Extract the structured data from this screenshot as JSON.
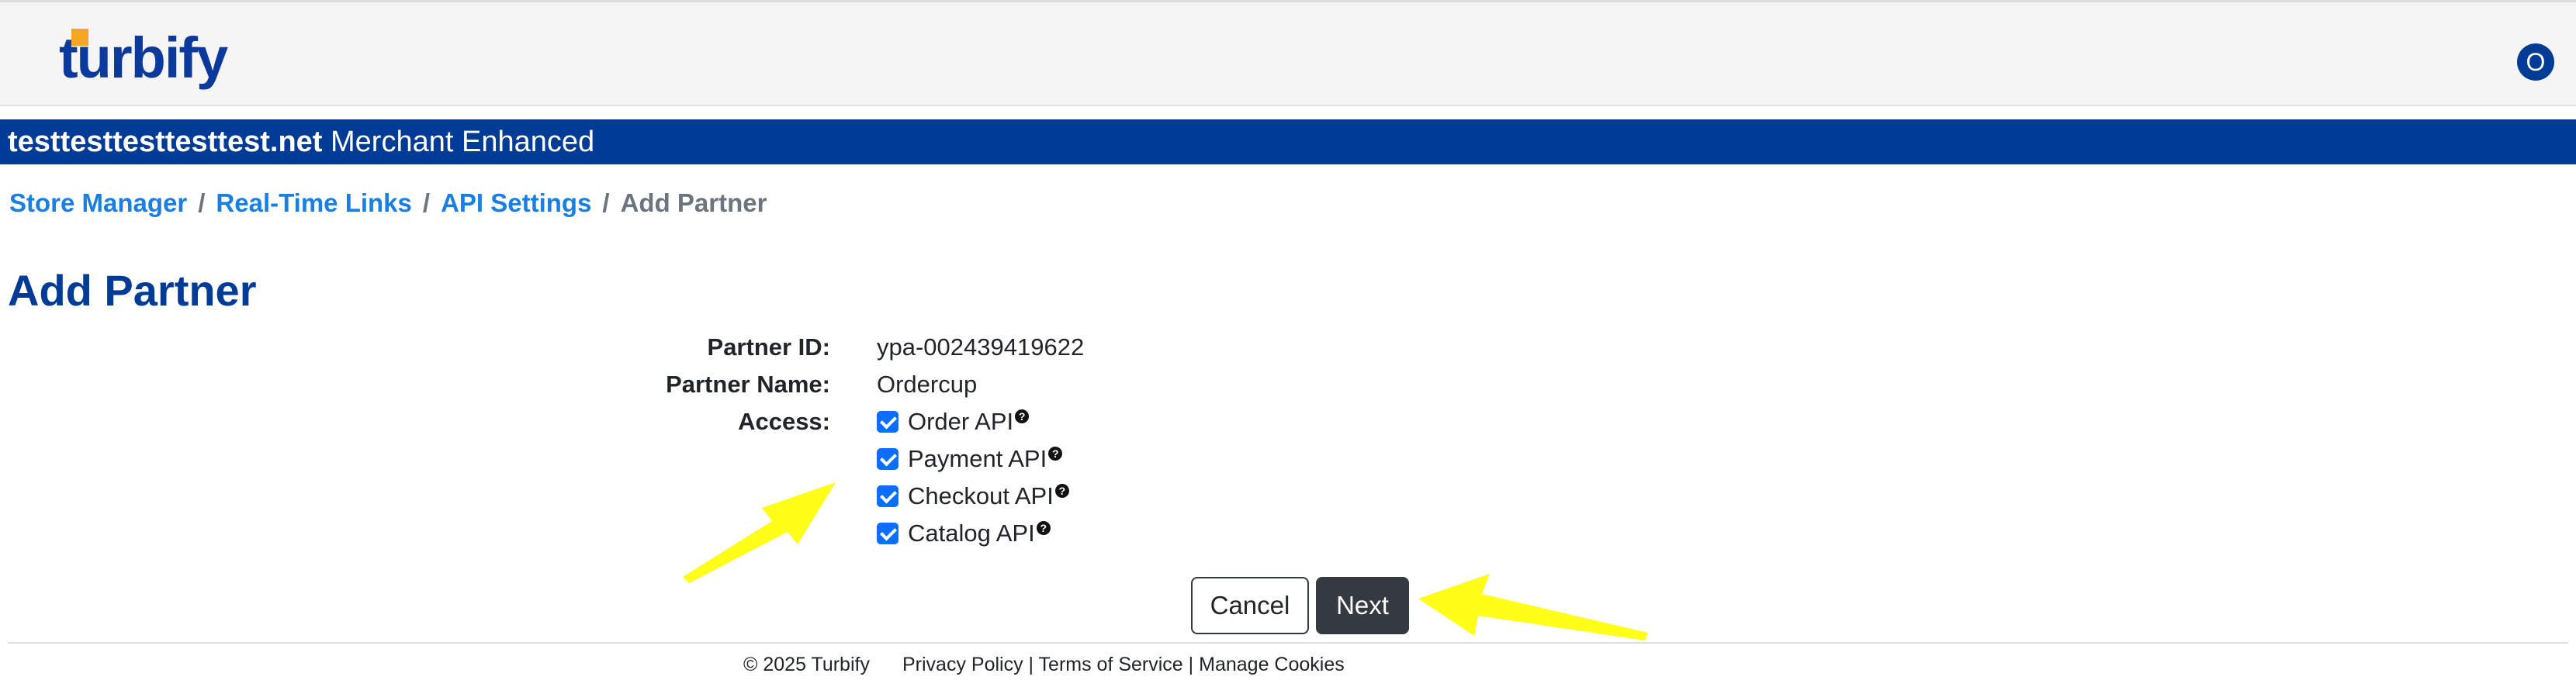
{
  "header": {
    "logo_text": "turbify",
    "avatar_letter": "O"
  },
  "store_bar": {
    "domain": "testtesttesttesttest.net",
    "plan": "Merchant Enhanced"
  },
  "breadcrumb": {
    "items": [
      "Store Manager",
      "Real-Time Links",
      "API Settings"
    ],
    "separator": "/",
    "current": "Add Partner"
  },
  "page": {
    "title": "Add Partner"
  },
  "form": {
    "partner_id_label": "Partner ID:",
    "partner_id_value": "ypa-002439419622",
    "partner_name_label": "Partner Name:",
    "partner_name_value": "Ordercup",
    "access_label": "Access:",
    "access_options": [
      {
        "label": "Order API",
        "checked": true
      },
      {
        "label": "Payment API",
        "checked": true
      },
      {
        "label": "Checkout API",
        "checked": true
      },
      {
        "label": "Catalog API",
        "checked": true
      }
    ],
    "help_glyph": "?"
  },
  "buttons": {
    "cancel": "Cancel",
    "next": "Next"
  },
  "footer": {
    "copyright": "© 2025 Turbify",
    "privacy": "Privacy Policy",
    "terms": "Terms of Service",
    "cookies": "Manage Cookies",
    "separator": "|"
  },
  "colors": {
    "brand_blue": "#003b95",
    "link_blue": "#1a7fe0",
    "checkbox_blue": "#0b6efd",
    "annotation_yellow": "#ffff1a"
  }
}
